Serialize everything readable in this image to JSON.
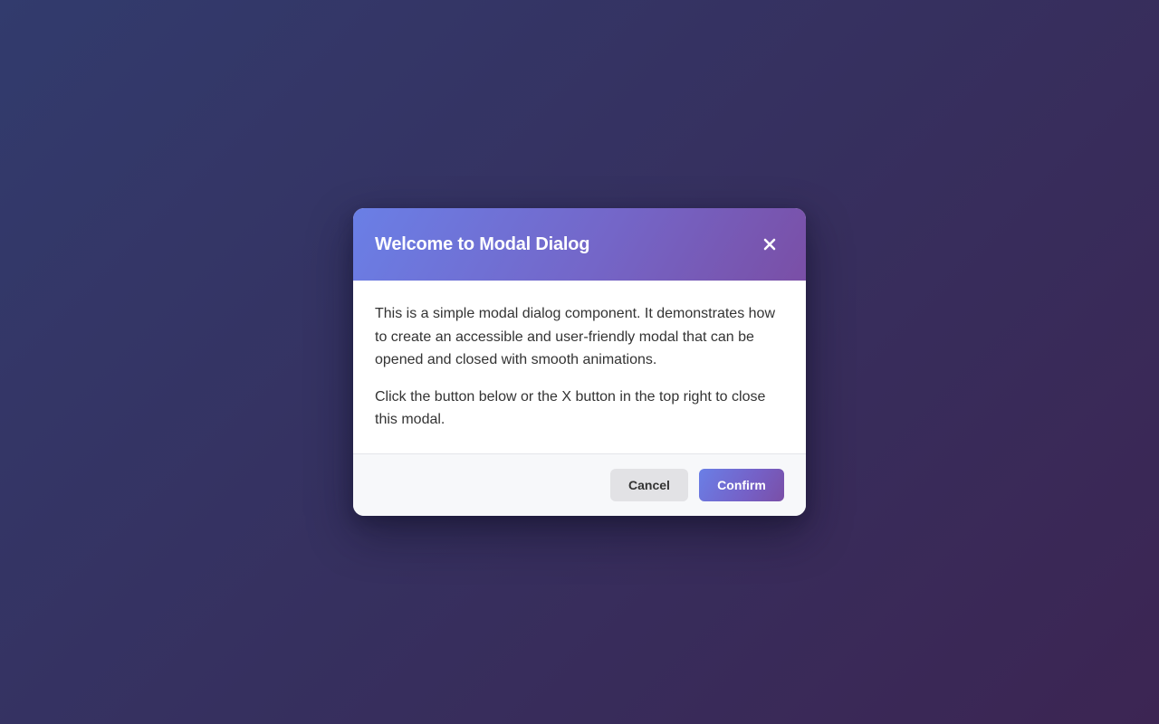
{
  "modal": {
    "title": "Welcome to Modal Dialog",
    "close_icon": "close-icon",
    "paragraphs": [
      "This is a simple modal dialog component. It demonstrates how to create an accessible and user-friendly modal that can be opened and closed with smooth animations.",
      "Click the button below or the X button in the top right to close this modal."
    ],
    "footer": {
      "cancel_label": "Cancel",
      "confirm_label": "Confirm"
    }
  },
  "colors": {
    "background_start": "#323b6d",
    "background_end": "#3c2553",
    "header_start": "#6a7fe6",
    "header_end": "#7a4fa6",
    "cancel_bg": "#e2e2e5",
    "footer_bg": "#f7f8fa"
  }
}
